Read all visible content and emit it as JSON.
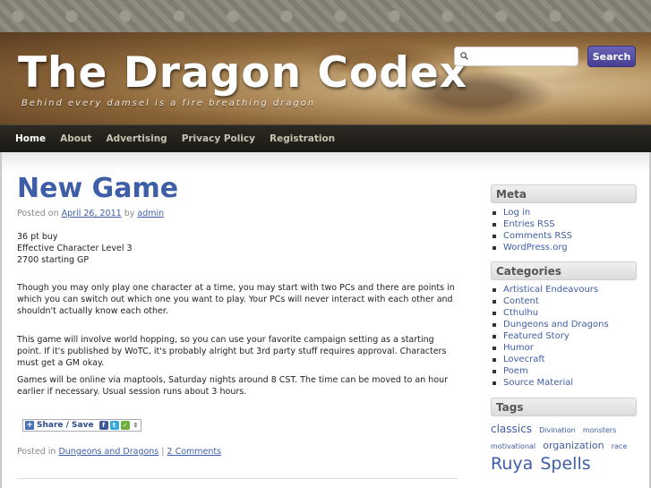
{
  "site": {
    "title": "The Dragon Codex",
    "tagline": "Behind every damsel is a fire breathing dragon"
  },
  "search": {
    "placeholder": "",
    "button_label": "Search"
  },
  "nav": {
    "items": [
      {
        "label": "Home",
        "active": true
      },
      {
        "label": "About",
        "active": false
      },
      {
        "label": "Advertising",
        "active": false
      },
      {
        "label": "Privacy Policy",
        "active": false
      },
      {
        "label": "Registration",
        "active": false
      }
    ]
  },
  "post": {
    "title": "New Game",
    "posted_on_prefix": "Posted on",
    "date": "April 26, 2011",
    "by_prefix": "by",
    "author": "admin",
    "lines": [
      "36 pt buy",
      "Effective Character Level 3",
      "2700 starting GP"
    ],
    "paragraphs": [
      "Though you may only play one character at a time, you may start with two PCs and there are points in which you can switch out which one you want to play. Your PCs will never interact with each other and shouldn't actually know each other.",
      "This game will involve world hopping, so you can use your favorite campaign setting as a starting point. If it's published by WoTC, it's probably alright but 3rd party stuff requires approval. Characters must get a GM okay.",
      "Games will be online via maptools, Saturday nights around 8 CST. The time can be moved to an hour earlier if necessary. Usual session runs about 3 hours."
    ],
    "share_label": "Share / Save",
    "posted_in_prefix": "Posted in",
    "category": "Dungeons and Dragons",
    "separator": "|",
    "comments": "2 Comments"
  },
  "sidebar": {
    "meta": {
      "title": "Meta",
      "items": [
        "Log in",
        "Entries RSS",
        "Comments RSS",
        "WordPress.org"
      ]
    },
    "categories": {
      "title": "Categories",
      "items": [
        "Artistical Endeavours",
        "Content",
        "Cthulhu",
        "Dungeons and Dragons",
        "Featured Story",
        "Humor",
        "Lovecraft",
        "Poem",
        "Source Material"
      ]
    },
    "tags": {
      "title": "Tags",
      "items": [
        {
          "label": "classics",
          "size": "large"
        },
        {
          "label": "Divination",
          "size": "small"
        },
        {
          "label": "monsters",
          "size": "small"
        },
        {
          "label": "motivational",
          "size": "small"
        },
        {
          "label": "organization",
          "size": "medium"
        },
        {
          "label": "race",
          "size": "small"
        },
        {
          "label": "Ruya",
          "size": "xlarge"
        },
        {
          "label": "Spells",
          "size": "xlarge"
        }
      ]
    }
  }
}
